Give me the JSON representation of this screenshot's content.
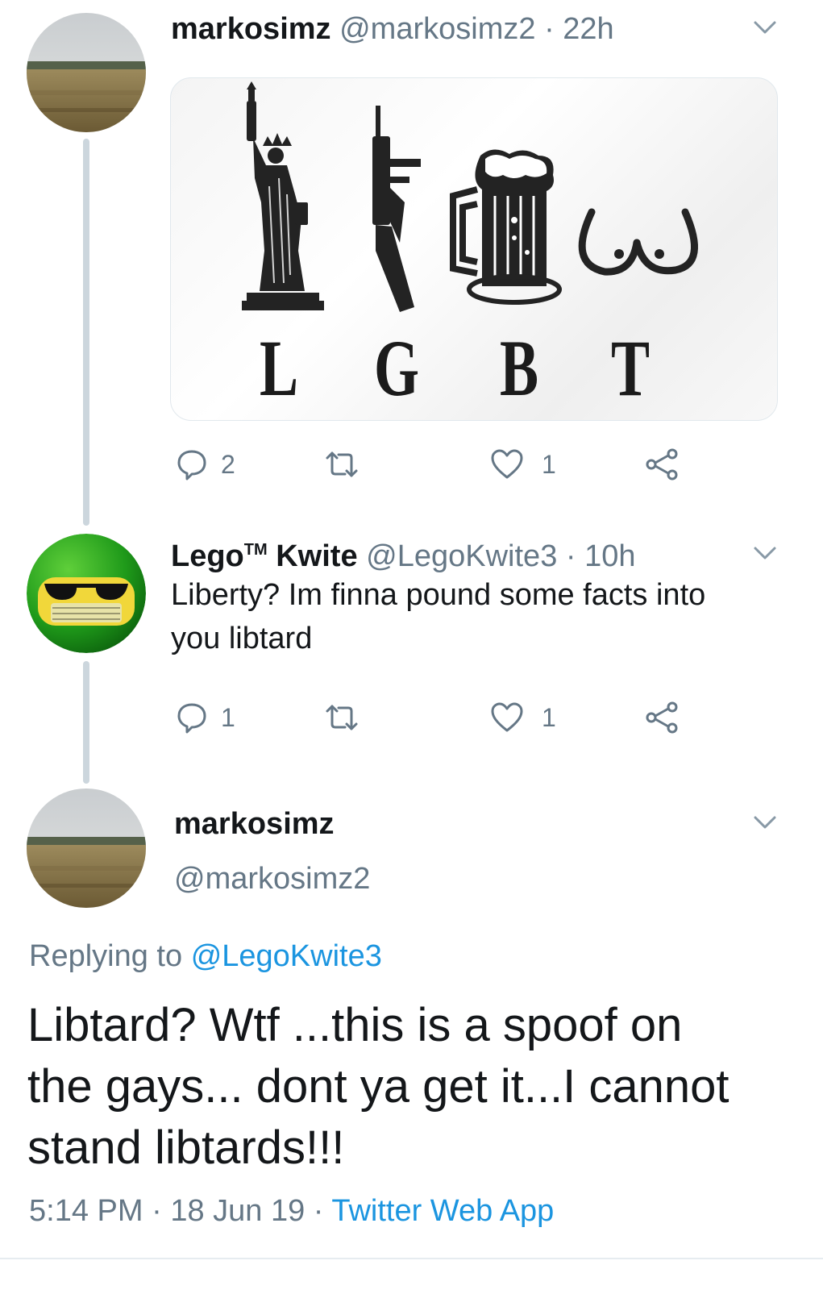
{
  "tweet1": {
    "name": "markosimz",
    "handle": "@markosimz2",
    "time": "22h",
    "separator": "·",
    "media": {
      "letters": [
        "L",
        "G",
        "B",
        "T"
      ]
    },
    "actions": {
      "replies": "2",
      "retweets": "",
      "likes": "1"
    }
  },
  "tweet2": {
    "name": "Lego",
    "name_tm": "TM",
    "name_rest": "Kwite",
    "handle": "@LegoKwite3",
    "time": "10h",
    "separator": "·",
    "text_line1": "Liberty? Im finna pound some facts into",
    "text_line2": "you libtard",
    "actions": {
      "replies": "1",
      "retweets": "",
      "likes": "1"
    }
  },
  "tweet3": {
    "name": "markosimz",
    "handle": "@markosimz2",
    "replying_prefix": "Replying to",
    "replying_to": "@LegoKwite3",
    "text_line1": "Libtard? Wtf ...this is a spoof on",
    "text_line2": "the gays... dont ya get it...I cannot",
    "text_line3": "stand libtards!!!",
    "time": "5:14 PM",
    "date": "18 Jun 19",
    "separator": "·",
    "source": "Twitter Web App"
  },
  "icons": {
    "reply": "speech-bubble-icon",
    "retweet": "retweet-arrows-icon",
    "like": "heart-outline-icon",
    "share": "share-nodes-icon",
    "more": "chevron-down-icon"
  },
  "colors": {
    "text": "#14171a",
    "secondary": "#657786",
    "link": "#1b95e0",
    "thread_line": "#ccd6dd"
  }
}
